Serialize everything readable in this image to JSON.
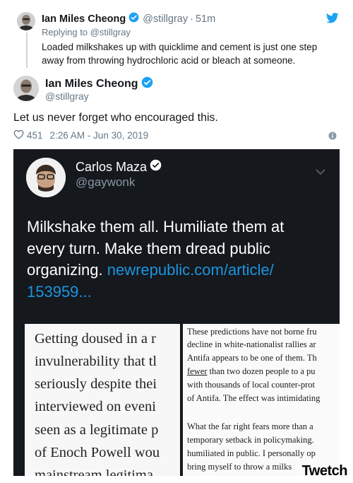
{
  "reply_tweet": {
    "name": "Ian Miles Cheong",
    "handle": "@stillgray",
    "separator": "·",
    "time": "51m",
    "replying_prefix": "Replying to",
    "replying_to": "@stillgray",
    "text_line1": "Loaded milkshakes up with quicklime and cement is just one step",
    "text_line2": "away from throwing hydrochloric acid or bleach at someone."
  },
  "main_tweet": {
    "name": "Ian Miles Cheong",
    "handle": "@stillgray",
    "text": "Let us never forget who encouraged this.",
    "likes": "451",
    "timestamp": "2:26 AM - Jun 30, 2019"
  },
  "embedded": {
    "name": "Carlos Maza",
    "handle": "@gaywonk",
    "text_line1": "Milkshake them all. Humiliate them at",
    "text_line2": "every turn. Make them dread public",
    "text_line3_plain": "organizing. ",
    "text_line3_link": "newrepublic.com/article/",
    "text_line4_link": "153959...",
    "article_left": [
      "Getting doused in a r",
      "invulnerability that tl",
      "seriously despite thei",
      "interviewed on eveni",
      "seen as a legitimate p",
      "of Enoch Powell wou",
      "mainstream legitima"
    ],
    "article_right": [
      "These predictions have not borne fru",
      "decline in white-nationalist rallies ar",
      "Antifa appears to be one of them. Th",
      "fewer",
      " than two dozen people to a pu",
      "with thousands of local counter-prot",
      "of Antifa. The effect was intimidating",
      "What the far right fears more than a",
      "temporary setback in policymaking.",
      "humiliated in public. I personally op",
      "bring myself to throw a milks"
    ]
  },
  "watermark": "Twetch",
  "colors": {
    "twitter_blue": "#1da1f2",
    "link_blue": "#1b95e0",
    "gray_text": "#657786",
    "dark_bg": "#15181c"
  },
  "icons": [
    "twitter-bird-icon",
    "verified-badge-icon",
    "heart-icon",
    "info-icon",
    "chevron-down-icon"
  ]
}
